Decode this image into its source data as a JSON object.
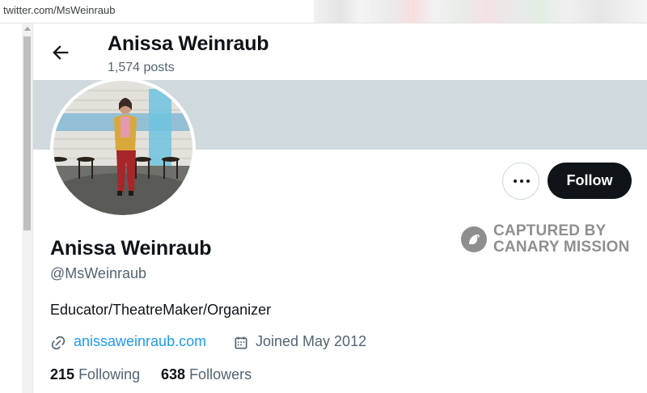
{
  "browser": {
    "url": "twitter.com/MsWeinraub"
  },
  "header": {
    "name": "Anissa Weinraub",
    "posts": "1,574 posts",
    "back_icon": "arrow-left-icon"
  },
  "actions": {
    "more_icon": "more-dots-icon",
    "follow_label": "Follow"
  },
  "watermark": {
    "line1": "CAPTURED BY",
    "line2": "CANARY MISSION"
  },
  "profile": {
    "name": "Anissa Weinraub",
    "handle": "@MsWeinraub",
    "bio": "Educator/TheatreMaker/Organizer",
    "website": "anissaweinraub.com",
    "joined": "Joined May 2012",
    "following_count": "215",
    "following_label": "Following",
    "followers_count": "638",
    "followers_label": "Followers"
  },
  "colors": {
    "accent": "#1d9bf0",
    "banner": "#cfd9de",
    "text": "#0f1419",
    "secondary": "#536471",
    "follow_bg": "#0f1419"
  }
}
